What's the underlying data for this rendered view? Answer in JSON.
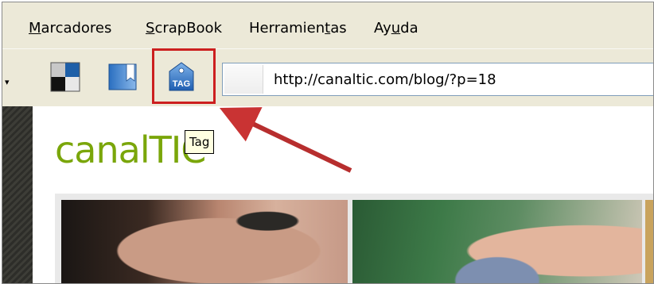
{
  "menu": {
    "items": [
      {
        "pre": "",
        "key": "M",
        "post": "arcadores"
      },
      {
        "pre": "",
        "key": "S",
        "post": "crapBook"
      },
      {
        "pre": "Herramien",
        "key": "t",
        "post": "as"
      },
      {
        "pre": "Ay",
        "key": "u",
        "post": "da"
      }
    ]
  },
  "toolbar": {
    "buttons": [
      {
        "name": "checker-icon"
      },
      {
        "name": "bookmark-icon"
      },
      {
        "name": "tag-icon",
        "label": "TAG"
      }
    ],
    "url": "http://canaltic.com/blog/?p=18"
  },
  "tooltip": {
    "text": "Tag"
  },
  "page": {
    "logo": "canalTIC"
  },
  "colors": {
    "highlight": "#cc1f1f",
    "logo": "#7aa60a",
    "tooltip_bg": "#ffffe1"
  }
}
